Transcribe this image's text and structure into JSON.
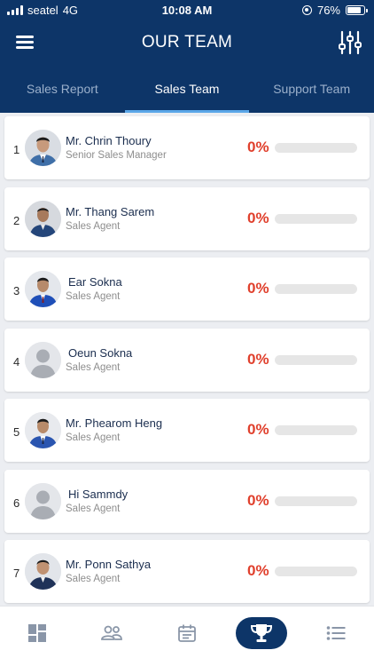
{
  "status_bar": {
    "carrier": "seatel",
    "network": "4G",
    "time": "10:08 AM",
    "battery": "76%"
  },
  "header": {
    "title": "OUR TEAM",
    "menu_icon": "hamburger-menu-icon",
    "filter_icon": "sliders-icon"
  },
  "tabs": [
    {
      "label": "Sales Report",
      "active": false
    },
    {
      "label": "Sales Team",
      "active": true
    },
    {
      "label": "Support Team",
      "active": false
    }
  ],
  "members": [
    {
      "rank": "1",
      "name": "Mr. Chrin Thoury",
      "role": "Senior Sales Manager",
      "percent": "0%",
      "progress": 0,
      "avatar": "photo"
    },
    {
      "rank": "2",
      "name": "Mr. Thang Sarem",
      "role": "Sales Agent",
      "percent": "0%",
      "progress": 0,
      "avatar": "photo"
    },
    {
      "rank": "3",
      "name": "Ear Sokna",
      "role": "Sales Agent",
      "percent": "0%",
      "progress": 0,
      "avatar": "photo"
    },
    {
      "rank": "4",
      "name": "Oeun Sokna",
      "role": "Sales Agent",
      "percent": "0%",
      "progress": 0,
      "avatar": "placeholder"
    },
    {
      "rank": "5",
      "name": "Mr. Phearom Heng",
      "role": "Sales Agent",
      "percent": "0%",
      "progress": 0,
      "avatar": "photo"
    },
    {
      "rank": "6",
      "name": "Hi Sammdy",
      "role": "Sales Agent",
      "percent": "0%",
      "progress": 0,
      "avatar": "placeholder"
    },
    {
      "rank": "7",
      "name": "Mr. Ponn Sathya",
      "role": "Sales Agent",
      "percent": "0%",
      "progress": 0,
      "avatar": "photo"
    }
  ],
  "bottom_nav": [
    {
      "icon": "dashboard-icon",
      "active": false
    },
    {
      "icon": "team-icon",
      "active": false
    },
    {
      "icon": "calendar-icon",
      "active": false
    },
    {
      "icon": "trophy-icon",
      "active": true
    },
    {
      "icon": "list-icon",
      "active": false
    }
  ],
  "colors": {
    "primary": "#0d3568",
    "accent": "#e0402d",
    "tab_indicator": "#5ba7e8"
  }
}
